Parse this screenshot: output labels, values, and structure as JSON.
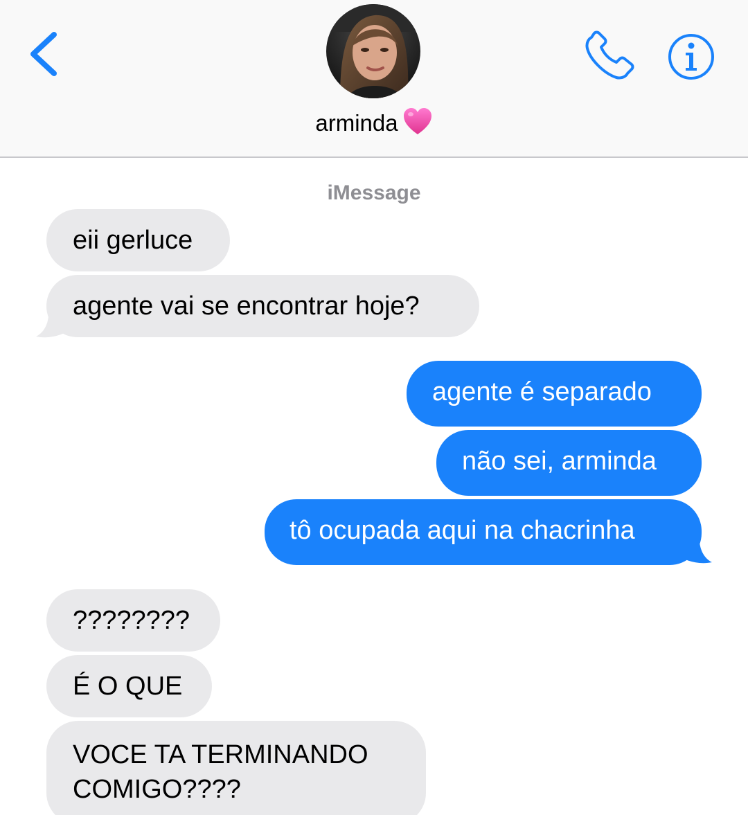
{
  "header": {
    "contact_name": "arminda",
    "name_emoji": "pink-heart",
    "back_icon": "chevron-left-icon",
    "call_icon": "phone-icon",
    "info_icon": "info-icon",
    "accent_color": "#1a82fb"
  },
  "transcript": {
    "service_label": "iMessage",
    "messages": [
      {
        "direction": "incoming",
        "text": "eii gerluce"
      },
      {
        "direction": "incoming",
        "text": "agente vai se encontrar hoje?"
      },
      {
        "direction": "outgoing",
        "text": "agente é separado"
      },
      {
        "direction": "outgoing",
        "text": "não sei, arminda"
      },
      {
        "direction": "outgoing",
        "text": "tô ocupada aqui na chacrinha"
      },
      {
        "direction": "incoming",
        "text": "????????"
      },
      {
        "direction": "incoming",
        "text": "É O QUE"
      },
      {
        "direction": "incoming",
        "text": "VOCE TA TERMINANDO COMIGO????"
      }
    ]
  },
  "colors": {
    "incoming_bubble": "#e9e9eb",
    "outgoing_bubble": "#1a82fb",
    "header_background": "#f9f9f9",
    "service_label": "#8e8e93"
  }
}
